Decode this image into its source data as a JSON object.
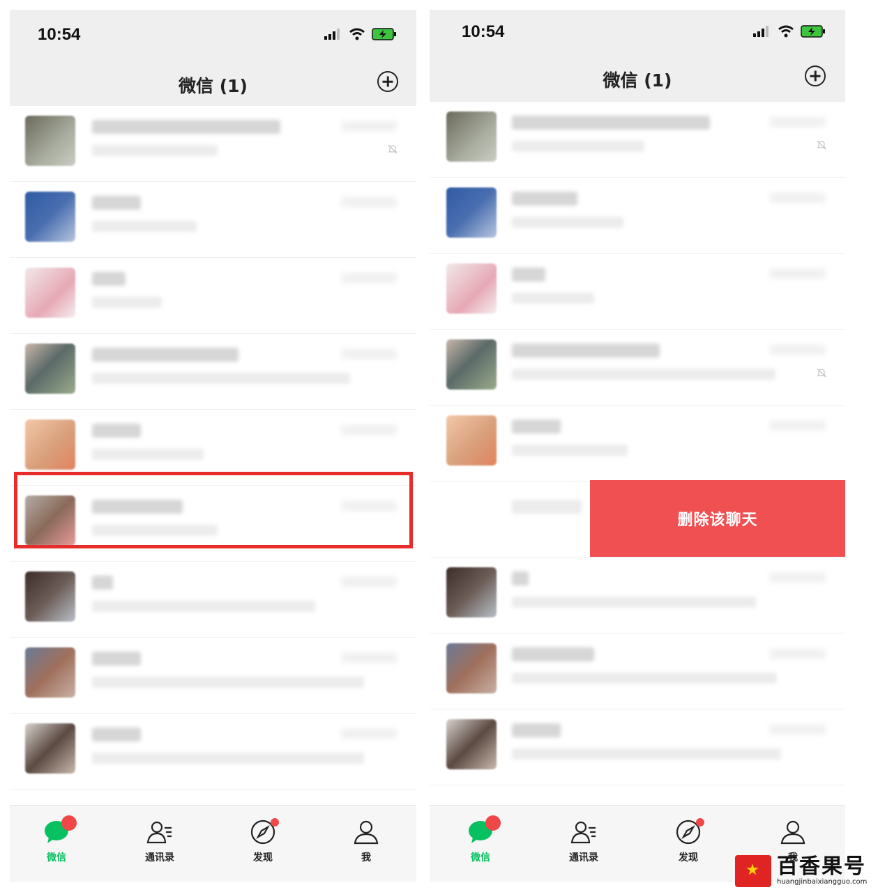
{
  "status": {
    "time": "10:54"
  },
  "nav": {
    "title": "微信 (1)"
  },
  "action": {
    "delete_label": "删除该聊天"
  },
  "tabs": [
    {
      "label": "微信",
      "icon": "chat-bubble-icon"
    },
    {
      "label": "通讯录",
      "icon": "contacts-icon"
    },
    {
      "label": "发现",
      "icon": "compass-icon"
    },
    {
      "label": "我",
      "icon": "person-icon"
    }
  ],
  "watermark": {
    "name": "百香果号",
    "url": "huangjinbaixiangguo.com"
  },
  "colors": {
    "accent": "#07c160",
    "badge": "#f04848",
    "delete": "#f05052",
    "highlight": "#e72c2c"
  }
}
